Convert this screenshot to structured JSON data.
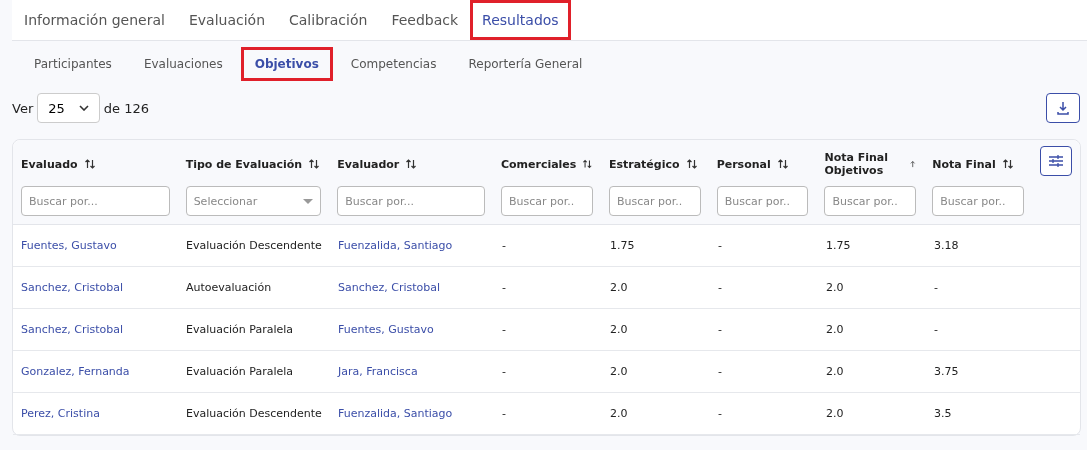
{
  "tabs": [
    {
      "label": "Información general",
      "selected": false,
      "highlighted": false
    },
    {
      "label": "Evaluación",
      "selected": false,
      "highlighted": false
    },
    {
      "label": "Calibración",
      "selected": false,
      "highlighted": false
    },
    {
      "label": "Feedback",
      "selected": false,
      "highlighted": false
    },
    {
      "label": "Resultados",
      "selected": true,
      "highlighted": true
    }
  ],
  "subtabs": [
    {
      "label": "Participantes",
      "selected": false,
      "highlighted": false
    },
    {
      "label": "Evaluaciones",
      "selected": false,
      "highlighted": false
    },
    {
      "label": "Objetivos",
      "selected": true,
      "highlighted": true
    },
    {
      "label": "Competencias",
      "selected": false,
      "highlighted": false
    },
    {
      "label": "Reportería General",
      "selected": false,
      "highlighted": false
    }
  ],
  "pager": {
    "prefix": "Ver",
    "page_size": "25",
    "suffix": "de 126"
  },
  "table": {
    "columns": [
      {
        "label": "Evaluado",
        "sorted_ascending": false,
        "filter": {
          "kind": "text",
          "placeholder": "Buscar por..."
        }
      },
      {
        "label": "Tipo de Evaluación",
        "sorted_ascending": false,
        "filter": {
          "kind": "select",
          "placeholder": "Seleccionar"
        }
      },
      {
        "label": "Evaluador",
        "sorted_ascending": false,
        "filter": {
          "kind": "text",
          "placeholder": "Buscar por..."
        }
      },
      {
        "label": "Comerciales",
        "sorted_ascending": false,
        "filter": {
          "kind": "text",
          "placeholder": "Buscar por.."
        }
      },
      {
        "label": "Estratégico",
        "sorted_ascending": false,
        "filter": {
          "kind": "text",
          "placeholder": "Buscar por.."
        }
      },
      {
        "label": "Personal",
        "sorted_ascending": false,
        "filter": {
          "kind": "text",
          "placeholder": "Buscar por.."
        }
      },
      {
        "label": "Nota Final Objetivos",
        "sorted_ascending": true,
        "filter": {
          "kind": "text",
          "placeholder": "Buscar por.."
        }
      },
      {
        "label": "Nota Final",
        "sorted_ascending": false,
        "filter": {
          "kind": "text",
          "placeholder": "Buscar por.."
        }
      }
    ],
    "rows": [
      [
        "Fuentes, Gustavo",
        "Evaluación Descendente",
        "Fuenzalida, Santiago",
        "-",
        "1.75",
        "-",
        "1.75",
        "3.18"
      ],
      [
        "Sanchez, Cristobal",
        "Autoevaluación",
        "Sanchez, Cristobal",
        "-",
        "2.0",
        "-",
        "2.0",
        "-"
      ],
      [
        "Sanchez, Cristobal",
        "Evaluación Paralela",
        "Fuentes, Gustavo",
        "-",
        "2.0",
        "-",
        "2.0",
        "-"
      ],
      [
        "Gonzalez, Fernanda",
        "Evaluación Paralela",
        "Jara, Francisca",
        "-",
        "2.0",
        "-",
        "2.0",
        "3.75"
      ],
      [
        "Perez, Cristina",
        "Evaluación Descendente",
        "Fuenzalida, Santiago",
        "-",
        "2.0",
        "-",
        "2.0",
        "3.5"
      ]
    ]
  }
}
